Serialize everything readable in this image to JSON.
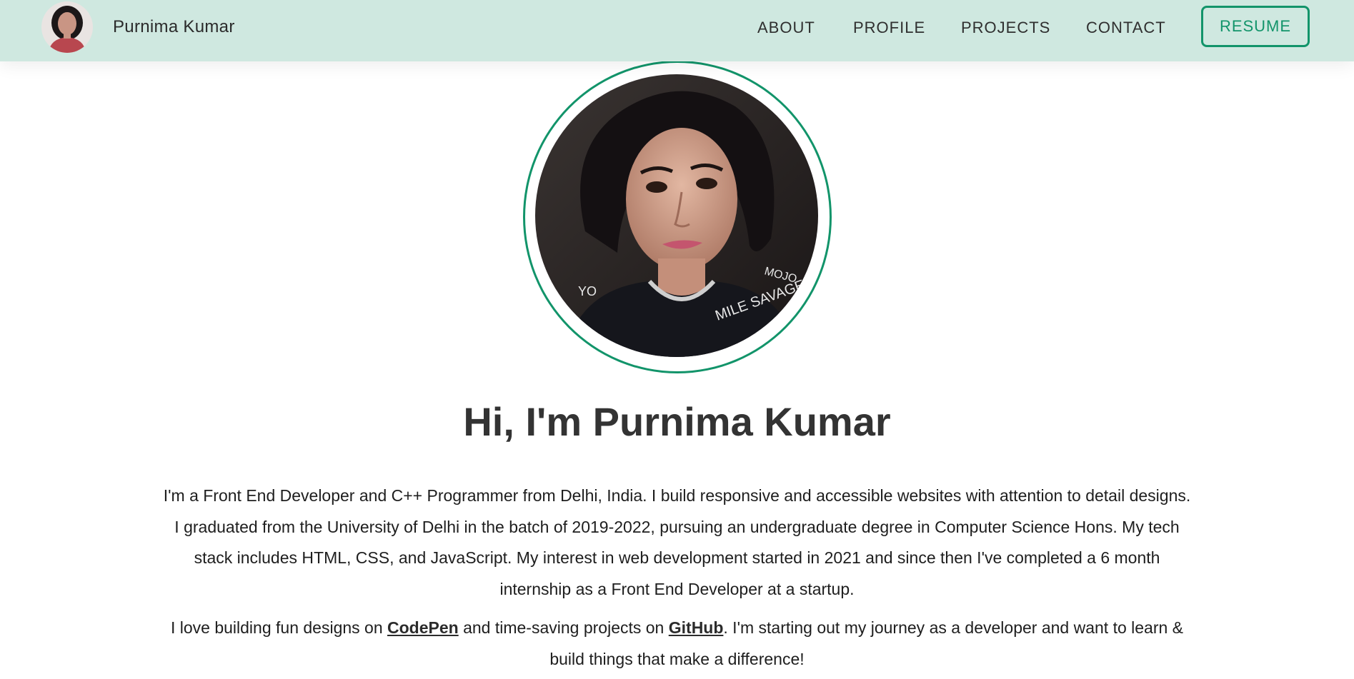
{
  "header": {
    "name": "Purnima Kumar",
    "nav": [
      {
        "label": "ABOUT"
      },
      {
        "label": "PROFILE"
      },
      {
        "label": "PROJECTS"
      },
      {
        "label": "CONTACT"
      }
    ],
    "resume_label": "RESUME"
  },
  "hero": {
    "title": "Hi, I'm Purnima Kumar",
    "bio_1": "I'm a Front End Developer and C++ Programmer from Delhi, India. I build responsive and accessible websites with attention to detail designs. I graduated from the University of Delhi in the batch of 2019-2022, pursuing an undergraduate degree in Computer Science Hons. My tech stack includes HTML, CSS, and JavaScript. My interest in web development started in 2021 and since then I've completed a 6 month internship as a Front End Developer at a startup.",
    "bio_2_part1": "I love building fun designs on ",
    "codepen_label": "CodePen",
    "bio_2_part2": " and time-saving projects on ",
    "github_label": "GitHub",
    "bio_2_part3": ". I'm starting out my journey as a developer and want to learn & build things that make a difference!"
  },
  "colors": {
    "header_bg": "#cfe8e0",
    "accent": "#12946a",
    "text_dark": "#333333"
  }
}
